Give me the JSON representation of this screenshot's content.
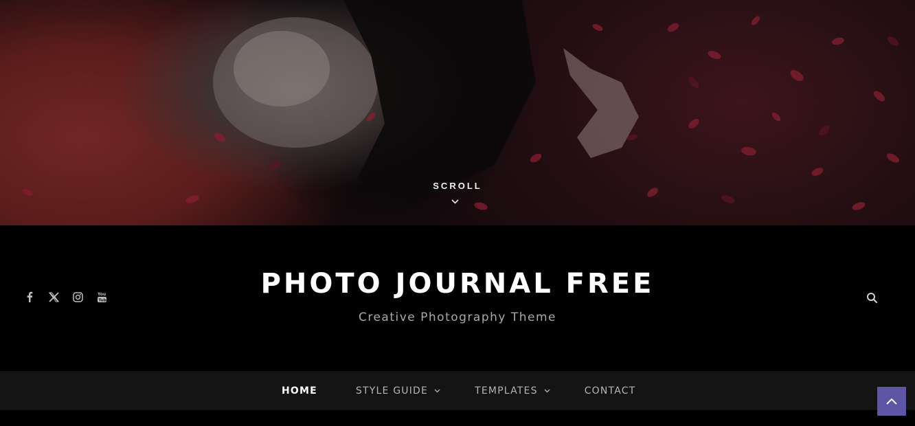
{
  "hero": {
    "scroll_label": "SCROLL",
    "icons": {
      "scroll": "chevron-down-icon"
    }
  },
  "header": {
    "site_title": "PHOTO JOURNAL FREE",
    "tagline": "Creative Photography Theme",
    "socials": [
      "facebook-icon",
      "x-twitter-icon",
      "instagram-icon",
      "youtube-icon"
    ],
    "search_icon": "search-icon"
  },
  "nav": {
    "items": [
      {
        "label": "HOME",
        "active": true,
        "dropdown": false
      },
      {
        "label": "STYLE GUIDE",
        "active": false,
        "dropdown": true
      },
      {
        "label": "TEMPLATES",
        "active": false,
        "dropdown": true
      },
      {
        "label": "CONTACT",
        "active": false,
        "dropdown": false
      }
    ]
  },
  "back_to_top": {
    "icon": "chevron-up-icon"
  },
  "colors": {
    "header_bg": "#000000",
    "nav_bg": "#141414",
    "accent": "#5e55a5",
    "tagline": "#a9a9a9"
  }
}
